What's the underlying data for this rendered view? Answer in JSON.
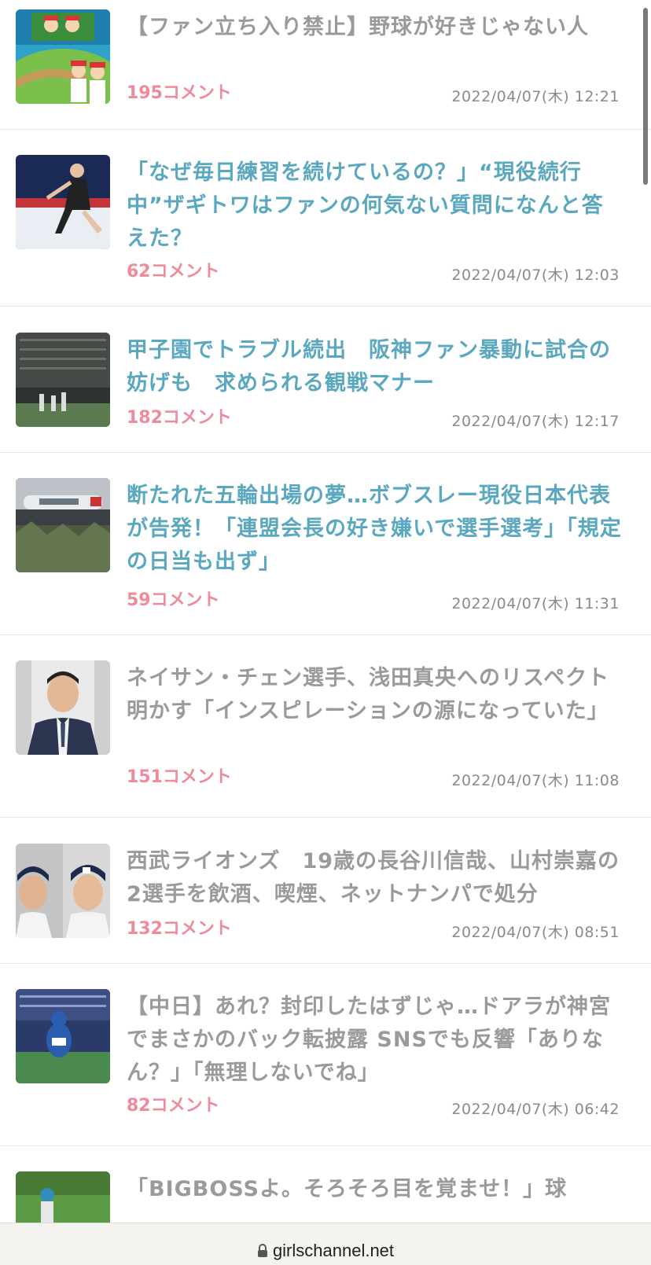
{
  "browser": {
    "url": "girlschannel.net"
  },
  "articles": [
    {
      "title": "【ファン立ち入り禁止】野球が好きじゃない人",
      "comments": "195コメント",
      "date": "2022/04/07(木) 12:21",
      "state": "read",
      "thumb": "baseball-illustration"
    },
    {
      "title": "「なぜ毎日練習を続けているの？」“現役続行中”ザギトワはファンの何気ない質問になんと答えた？",
      "comments": "62コメント",
      "date": "2022/04/07(木) 12:03",
      "state": "unread",
      "thumb": "figure-skater-photo"
    },
    {
      "title": "甲子園でトラブル続出　阪神ファン暴動に試合の妨げも　求められる観戦マナー",
      "comments": "182コメント",
      "date": "2022/04/07(木) 12:17",
      "state": "unread",
      "thumb": "stadium-photo"
    },
    {
      "title": "断たれた五輪出場の夢…ボブスレー現役日本代表が告発！「連盟会長の好き嫌いで選手選考」「規定の日当も出ず」",
      "comments": "59コメント",
      "date": "2022/04/07(木) 11:31",
      "state": "unread",
      "thumb": "bobsled-photo"
    },
    {
      "title": "ネイサン・チェン選手、浅田真央へのリスペクト明かす「インスピレーションの源になっていた」",
      "comments": "151コメント",
      "date": "2022/04/07(木) 11:08",
      "state": "read",
      "thumb": "skater-portrait-photo"
    },
    {
      "title": "西武ライオンズ　19歳の長谷川信哉、山村崇嘉の2選手を飲酒、喫煙、ネットナンパで処分",
      "comments": "132コメント",
      "date": "2022/04/07(木) 08:51",
      "state": "read",
      "thumb": "players-portrait-photo"
    },
    {
      "title": "【中日】あれ？封印したはずじゃ…ドアラが神宮でまさかのバック転披露 SNSでも反響「ありなん？」「無理しないでね」",
      "comments": "82コメント",
      "date": "2022/04/07(木) 06:42",
      "state": "read",
      "thumb": "mascot-photo"
    },
    {
      "title": "「BIGBOSSよ。そろそろ目を覚ませ！」球",
      "comments": "",
      "date": "",
      "state": "read",
      "thumb": "field-photo"
    }
  ]
}
